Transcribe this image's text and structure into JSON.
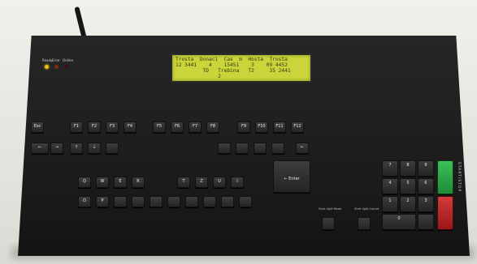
{
  "status_panel": {
    "labels": [
      "Ready",
      "Error",
      "Online"
    ]
  },
  "lcd": {
    "line1": "Trosta  Donaci  Cas  m  Hosta  Trosta",
    "line2": "12 3441    4    15451    3    09 4452",
    "line3": "         TD   Trebina   T2     35 2441",
    "line4": "              2"
  },
  "keys": {
    "f1": "F1",
    "f2": "F2",
    "f3": "F3",
    "f4": "F4",
    "f5": "F5",
    "f6": "F6",
    "f7": "F7",
    "f8": "F8",
    "f9": "F9",
    "f10": "F10",
    "f11": "F11",
    "f12": "F12",
    "esc": "Esc",
    "arrow_up": "↑",
    "arrow_down": "↓",
    "arrow_left": "←",
    "arrow_right": "→",
    "q": "Q",
    "w": "W",
    "e": "E",
    "r": "R",
    "t": "T",
    "z": "Z",
    "u": "U",
    "i": "I",
    "o": "O",
    "p": "P",
    "enter": "← Enter",
    "n1": "1",
    "n2": "2",
    "n3": "3",
    "n4": "4",
    "n5": "5",
    "n6": "6",
    "n7": "7",
    "n8": "8",
    "n9": "9",
    "n0": "0"
  },
  "side_labels": {
    "left": "Start light\nMode",
    "right": "Start light\nCancel"
  },
  "start_stop": "START/STOP"
}
